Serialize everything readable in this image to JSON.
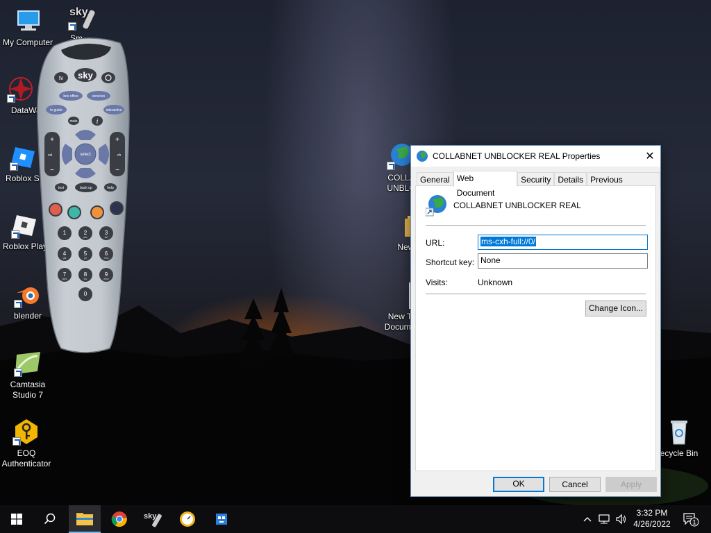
{
  "desktop": {
    "icons": [
      {
        "label": "My Computer"
      },
      {
        "label": "DataWage"
      },
      {
        "label": "Roblox St"
      },
      {
        "label": "Roblox Play"
      },
      {
        "label": "blender"
      },
      {
        "label": "Camtasia Studio 7"
      },
      {
        "label": "EOQ Authenticator"
      },
      {
        "label": "COLLA UNBLO"
      },
      {
        "label": "New fo"
      },
      {
        "label": "New T Docume"
      },
      {
        "label": "ecycle Bin"
      },
      {
        "label": "Sm"
      }
    ]
  },
  "remote": {
    "brand": "sky",
    "buttons": {
      "tv": "tv",
      "box_office": "box office",
      "services": "services",
      "tv_guide": "tv guide",
      "interactive": "interactive",
      "mute": "mute",
      "info": "i",
      "select": "select",
      "text": "text",
      "back_up": "back up",
      "help": "help",
      "vol": "vol",
      "ch": "ch",
      "plus": "+",
      "minus": "−",
      "digits": [
        {
          "n": "1",
          "s": ""
        },
        {
          "n": "2",
          "s": "abc"
        },
        {
          "n": "3",
          "s": "def"
        },
        {
          "n": "4",
          "s": "ghi"
        },
        {
          "n": "5",
          "s": "jkl"
        },
        {
          "n": "6",
          "s": "mno"
        },
        {
          "n": "7",
          "s": "pqrs"
        },
        {
          "n": "8",
          "s": "tuv"
        },
        {
          "n": "9",
          "s": "wxyz"
        },
        {
          "n": "0",
          "s": ""
        }
      ]
    },
    "colors": {
      "red": "#e0604f",
      "green": "#3fb6a8",
      "yellow": "#f0923a",
      "blue": "#2c3350"
    }
  },
  "dialog": {
    "title": "COLLABNET UNBLOCKER REAL Properties",
    "close_glyph": "✕",
    "tabs": [
      "General",
      "Web Document",
      "Security",
      "Details",
      "Previous Versions"
    ],
    "active_tab": "Web Document",
    "doc_name": "COLLABNET UNBLOCKER REAL",
    "url_label": "URL:",
    "url_value": "ms-cxh-full://0/",
    "shortcut_label": "Shortcut key:",
    "shortcut_value": "None",
    "visits_label": "Visits:",
    "visits_value": "Unknown",
    "change_icon_label": "Change Icon...",
    "ok_label": "OK",
    "cancel_label": "Cancel",
    "apply_label": "Apply"
  },
  "taskbar": {
    "time": "3:32 PM",
    "date": "4/26/2022",
    "notification_count": "1",
    "apps": [
      "start-button",
      "search-icon",
      "file-explorer-icon",
      "chrome-icon",
      "sky-remote-icon",
      "clock-app-icon",
      "robot-app-icon"
    ]
  }
}
